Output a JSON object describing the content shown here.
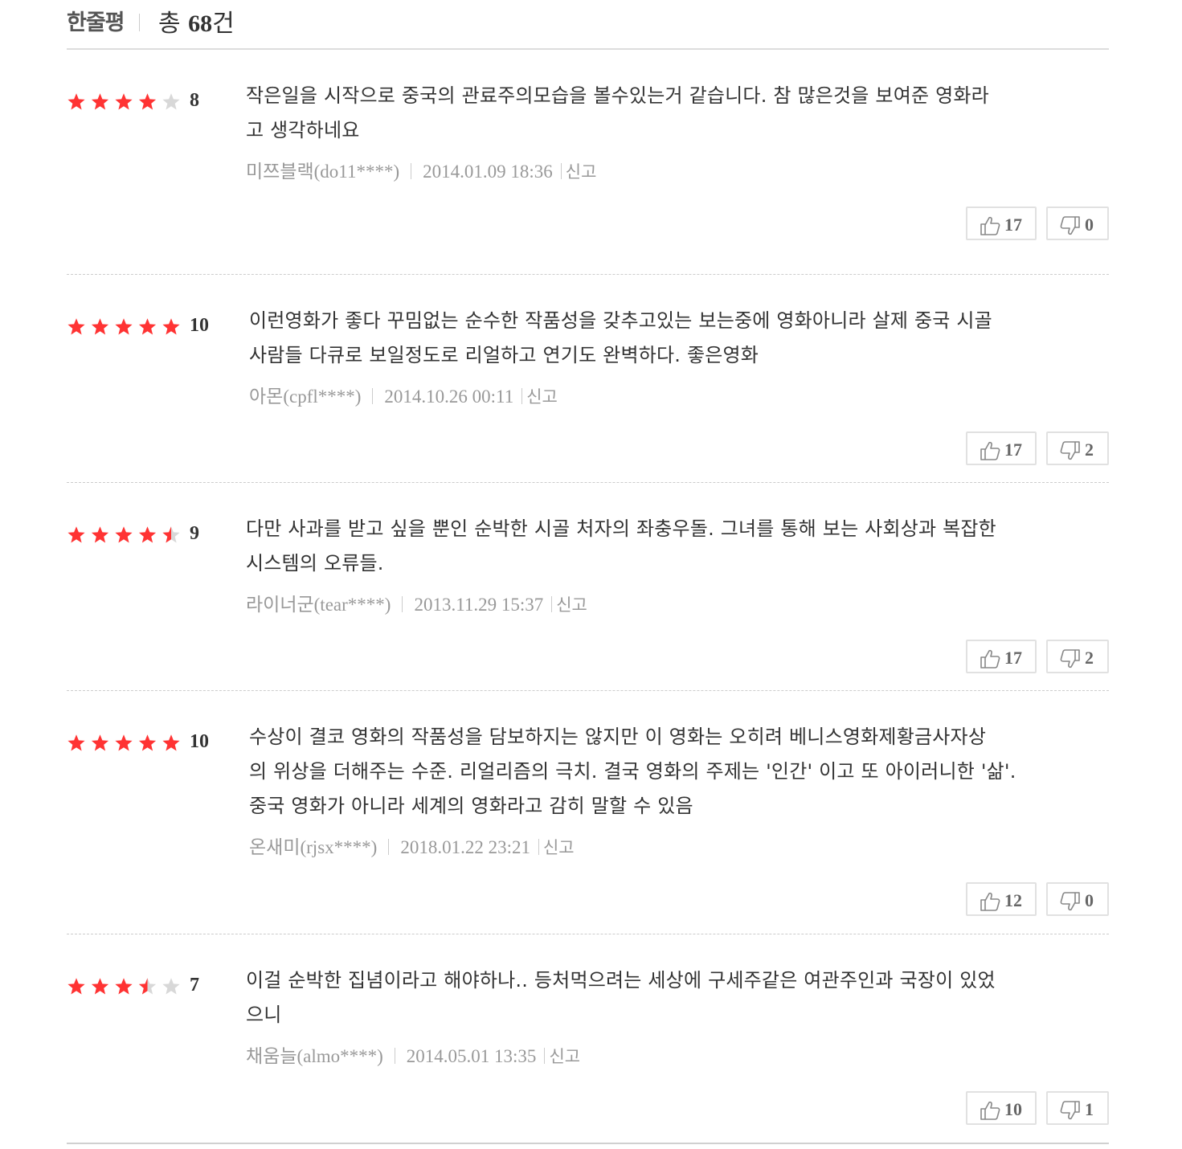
{
  "header": {
    "title": "한줄평",
    "total_prefix": "총 ",
    "total_count": "68",
    "total_suffix": "건"
  },
  "colors": {
    "star_on": "#ff3333",
    "star_off": "#d8d8d8",
    "meta": "#999999"
  },
  "reviews": [
    {
      "rating": 4,
      "score": "8",
      "lines": [
        "작은일을 시작으로 중국의 관료주의모습을 볼수있는거 같습니다. 참 많은것을 보여준 영화라",
        "고 생각하네요"
      ],
      "nickname": "미쯔블랙",
      "user": "(do11****)",
      "date": "2014.01.09 18:36",
      "report": "신고",
      "likes": "17",
      "dislikes": "0"
    },
    {
      "rating": 5,
      "score": "10",
      "lines": [
        "이런영화가 좋다 꾸밈없는 순수한 작품성을 갖추고있는 보는중에 영화아니라 살제 중국 시골",
        "사람들 다큐로 보일정도로 리얼하고 연기도 완벽하다. 좋은영화"
      ],
      "nickname": "아몬",
      "user": "(cpfl****)",
      "date": "2014.10.26 00:11",
      "report": "신고",
      "likes": "17",
      "dislikes": "2"
    },
    {
      "rating": 4.5,
      "score": "9",
      "lines": [
        "다만 사과를 받고 싶을 뿐인 순박한 시골 처자의 좌충우돌. 그녀를 통해 보는 사회상과 복잡한",
        "시스템의 오류들."
      ],
      "nickname": "라이너군",
      "user": "(tear****)",
      "date": "2013.11.29 15:37",
      "report": "신고",
      "likes": "17",
      "dislikes": "2"
    },
    {
      "rating": 5,
      "score": "10",
      "lines": [
        "수상이 결코 영화의 작품성을 담보하지는 않지만 이 영화는 오히려 베니스영화제황금사자상",
        "의 위상을 더해주는 수준. 리얼리즘의 극치. 결국 영화의 주제는 '인간' 이고 또 아이러니한 '삶'.",
        "중국 영화가 아니라 세계의 영화라고 감히 말할 수 있음"
      ],
      "nickname": "온새미",
      "user": "(rjsx****)",
      "date": "2018.01.22 23:21",
      "report": "신고",
      "likes": "12",
      "dislikes": "0"
    },
    {
      "rating": 3.5,
      "score": "7",
      "lines": [
        "이걸 순박한 집념이라고 해야하나.. 등처먹으려는 세상에 구세주같은 여관주인과 국장이 있었",
        "으니"
      ],
      "nickname": "채움늘",
      "user": "(almo****)",
      "date": "2014.05.01 13:35",
      "report": "신고",
      "likes": "10",
      "dislikes": "1"
    }
  ]
}
